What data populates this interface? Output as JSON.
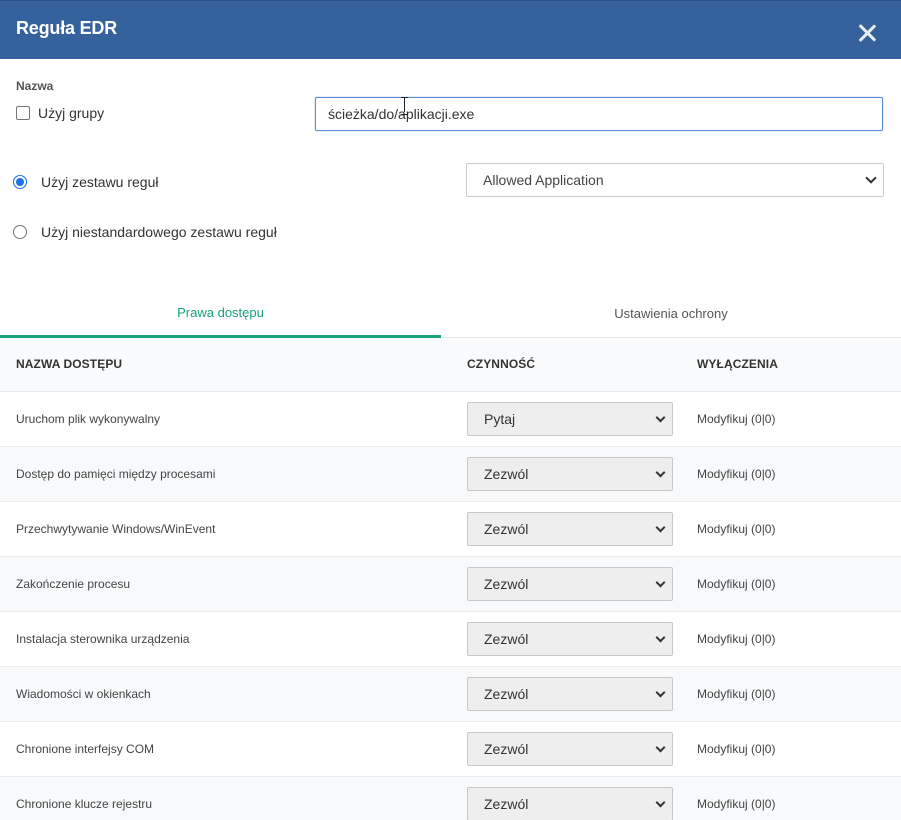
{
  "header": {
    "title": "Reguła EDR",
    "close_icon": "close-icon"
  },
  "name_section": {
    "label": "Nazwa",
    "use_group_label": "Użyj grupy",
    "use_group_checked": false,
    "path_value": "ścieżka/do/aplikacji.exe"
  },
  "ruleset": {
    "use_ruleset_label": "Użyj zestawu reguł",
    "use_custom_label": "Użyj niestandardowego zestawu reguł",
    "selected": "Allowed Application"
  },
  "tabs": [
    {
      "label": "Prawa dostępu",
      "active": true
    },
    {
      "label": "Ustawienia ochrony",
      "active": false
    }
  ],
  "table": {
    "headers": {
      "name": "NAZWA DOSTĘPU",
      "action": "CZYNNOŚĆ",
      "exclusions": "WYŁĄCZENIA"
    },
    "rows": [
      {
        "name": "Uruchom plik wykonywalny",
        "action": "Pytaj",
        "exclusions": "Modyfikuj (0|0)"
      },
      {
        "name": "Dostęp do pamięci między procesami",
        "action": "Zezwól",
        "exclusions": "Modyfikuj (0|0)"
      },
      {
        "name": "Przechwytywanie Windows/WinEvent",
        "action": "Zezwól",
        "exclusions": "Modyfikuj (0|0)"
      },
      {
        "name": "Zakończenie procesu",
        "action": "Zezwól",
        "exclusions": "Modyfikuj (0|0)"
      },
      {
        "name": "Instalacja sterownika urządzenia",
        "action": "Zezwól",
        "exclusions": "Modyfikuj (0|0)"
      },
      {
        "name": "Wiadomości w okienkach",
        "action": "Zezwól",
        "exclusions": "Modyfikuj (0|0)"
      },
      {
        "name": "Chronione interfejsy COM",
        "action": "Zezwól",
        "exclusions": "Modyfikuj (0|0)"
      },
      {
        "name": "Chronione klucze rejestru",
        "action": "Zezwól",
        "exclusions": "Modyfikuj (0|0)"
      }
    ]
  },
  "colors": {
    "header_bg": "#35629c",
    "tab_active": "#17a27c",
    "radio_checked": "#1a73e8"
  }
}
